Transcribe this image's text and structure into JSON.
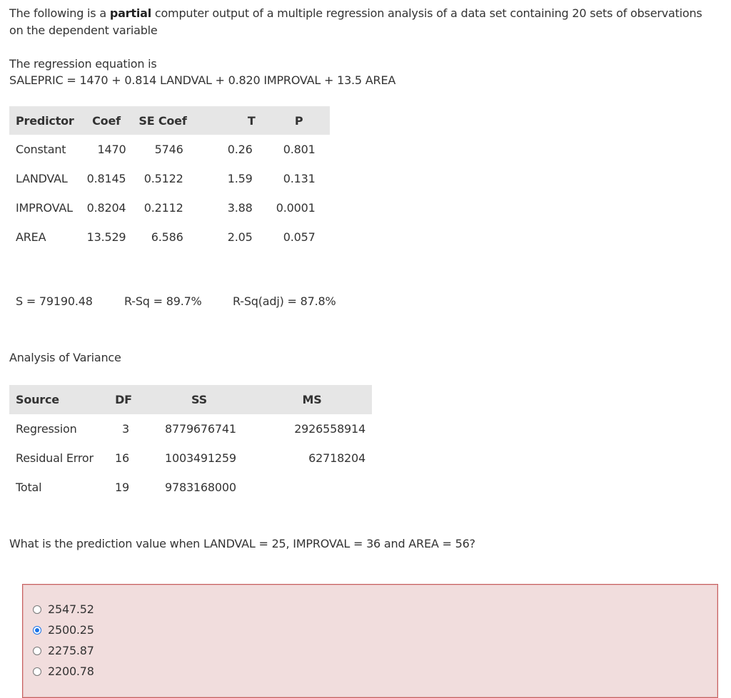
{
  "intro": {
    "before": "The following is a ",
    "bold": "partial",
    "after": " computer output of a multiple regression analysis of a data set containing 20 sets of observations on the dependent variable"
  },
  "equation": {
    "heading": "The regression equation is",
    "text": "SALEPRIC = 1470 + 0.814 LANDVAL + 0.820 IMPROVAL + 13.5 AREA"
  },
  "predictor_table": {
    "headers": [
      "Predictor",
      "Coef",
      "SE Coef",
      "T",
      "P"
    ],
    "rows": [
      [
        "Constant",
        "1470",
        "5746",
        "0.26",
        "0.801"
      ],
      [
        "LANDVAL",
        "0.8145",
        "0.5122",
        "1.59",
        "0.131"
      ],
      [
        "IMPROVAL",
        "0.8204",
        "0.2112",
        "3.88",
        "0.0001"
      ],
      [
        "AREA",
        "13.529",
        "6.586",
        "2.05",
        "0.057"
      ]
    ]
  },
  "stats": {
    "s": "S = 79190.48",
    "rsq": "R-Sq = 89.7%",
    "rsq_adj": "R-Sq(adj) = 87.8%"
  },
  "anova": {
    "title": "Analysis of Variance",
    "headers": [
      "Source",
      "DF",
      "SS",
      "MS"
    ],
    "rows": [
      [
        "Regression",
        "3",
        "8779676741",
        "2926558914"
      ],
      [
        "Residual Error",
        "16",
        "1003491259",
        "62718204"
      ],
      [
        "Total",
        "19",
        "9783168000",
        ""
      ]
    ]
  },
  "question": "What is the prediction value when LANDVAL = 25, IMPROVAL = 36 and AREA = 56?",
  "options": [
    {
      "label": "2547.52",
      "selected": false
    },
    {
      "label": "2500.25",
      "selected": true
    },
    {
      "label": "2275.87",
      "selected": false
    },
    {
      "label": "2200.78",
      "selected": false
    }
  ],
  "colors": {
    "header_bg": "#e6e6e6",
    "answer_bg": "#f1dddd",
    "answer_border": "#c66060",
    "radio_selected": "#1a73e8"
  }
}
